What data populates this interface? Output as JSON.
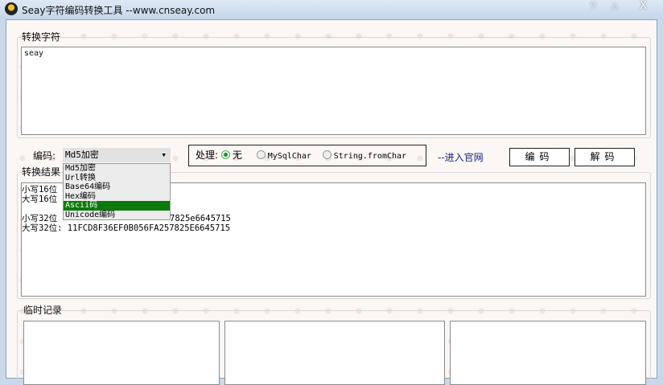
{
  "window": {
    "title": "Seay字符编码转换工具 --www.cnseay.com",
    "min": "▽",
    "max": "△",
    "close": "X"
  },
  "input_group": {
    "label": "转换字符",
    "value": "seay"
  },
  "encoding": {
    "label": "编码:",
    "selected": "Md5加密",
    "arrow": "▾",
    "options": [
      "Md5加密",
      "Url转换",
      "Base64编码",
      "Hex编码",
      "Ascii码",
      "Unicode编码"
    ],
    "highlighted_index": 4
  },
  "process": {
    "label": "处理:",
    "options": [
      "无",
      "MySqlChar",
      "String.fromChar"
    ],
    "selected": "无"
  },
  "official_link": "--进入官网",
  "encode_button": "编码",
  "decode_button": "解码",
  "result_group": {
    "label": "转换结果",
    "lines": [
      {
        "label": "小写16位",
        "value": ""
      },
      {
        "label": "大写16位",
        "value": ""
      },
      {
        "label": "小写32位",
        "value": "7825e6645715"
      },
      {
        "label": "大写32位:",
        "value": "11FCD8F36EF0B056FA257825E6645715"
      }
    ]
  },
  "history_group": {
    "label": "临时记录"
  }
}
